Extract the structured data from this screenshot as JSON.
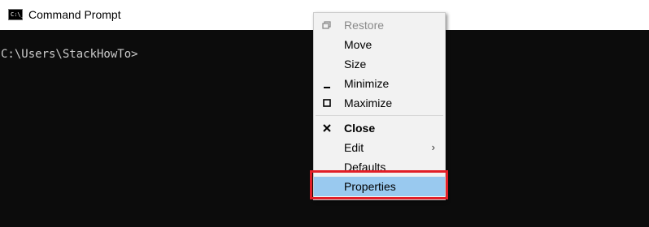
{
  "window": {
    "title": "Command Prompt",
    "icon": "cmd-icon",
    "icon_text": "C:\\_"
  },
  "console": {
    "prompt": "C:\\Users\\StackHowTo>"
  },
  "context_menu": {
    "items": [
      {
        "label": "Restore",
        "icon": "restore-icon",
        "disabled": true
      },
      {
        "label": "Move"
      },
      {
        "label": "Size"
      },
      {
        "label": "Minimize",
        "icon": "minimize-icon"
      },
      {
        "label": "Maximize",
        "icon": "maximize-icon"
      },
      {
        "label": "Close",
        "icon": "close-icon",
        "bold": true
      },
      {
        "label": "Edit",
        "submenu": true,
        "submenu_arrow": "›"
      },
      {
        "label": "Defaults"
      },
      {
        "label": "Properties",
        "selected": true
      }
    ],
    "highlight_color": "#e21e27",
    "selected_color": "#99c9ef"
  }
}
